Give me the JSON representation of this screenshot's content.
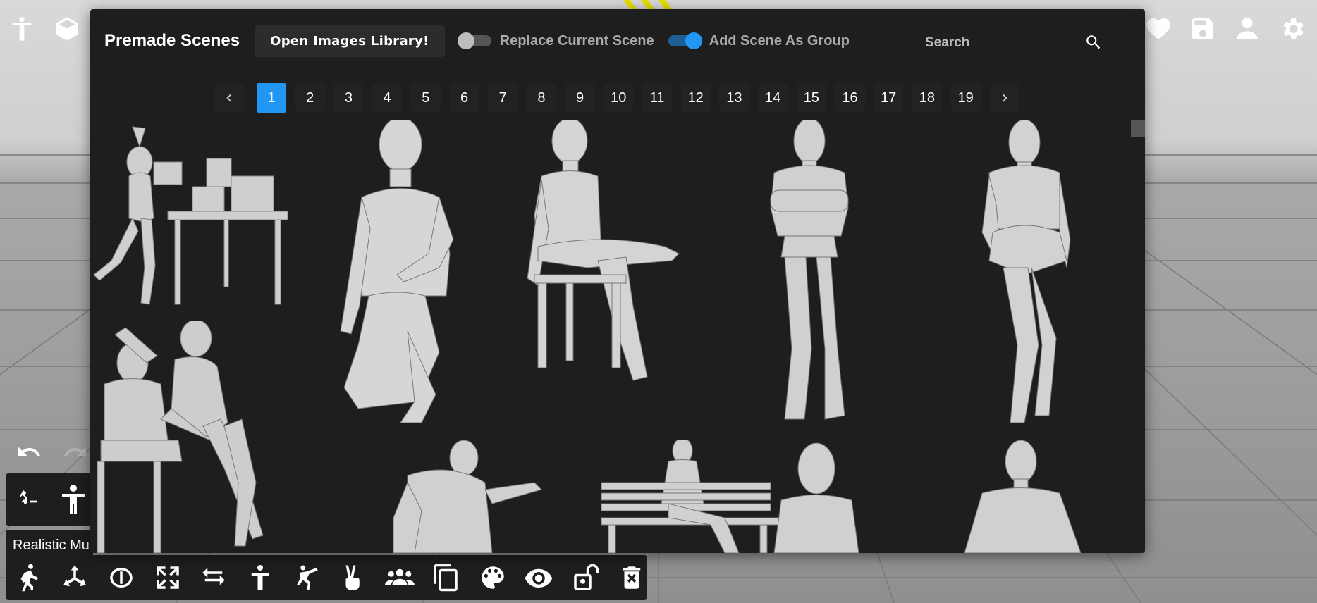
{
  "header": {
    "title": "Premade Scenes",
    "open_library_label": "Open Images Library!",
    "replace_toggle": {
      "label": "Replace Current Scene",
      "on": false
    },
    "group_toggle": {
      "label": "Add Scene As Group",
      "on": true
    },
    "search_placeholder": "Search"
  },
  "pagination": {
    "pages": [
      "1",
      "2",
      "3",
      "4",
      "5",
      "6",
      "7",
      "8",
      "9",
      "10",
      "11",
      "12",
      "13",
      "14",
      "15",
      "16",
      "17",
      "18",
      "19"
    ],
    "current": "1"
  },
  "side_label": "Realistic Mu",
  "colors": {
    "accent": "#2196f3",
    "panel": "#1e1e1e"
  },
  "top_icons_left": [
    "accessibility-icon",
    "cube-icon"
  ],
  "top_icons_right": [
    "heart-icon",
    "save-icon",
    "user-icon",
    "gear-icon"
  ],
  "toolbar_icons": [
    "pose-icon",
    "axes-icon",
    "rotate-icon",
    "expand-icon",
    "swap-icon",
    "figure-icon",
    "kick-icon",
    "hand-peace-icon",
    "group-icon",
    "copy-icon",
    "palette-icon",
    "eye-icon",
    "unlock-icon",
    "delete-icon"
  ]
}
